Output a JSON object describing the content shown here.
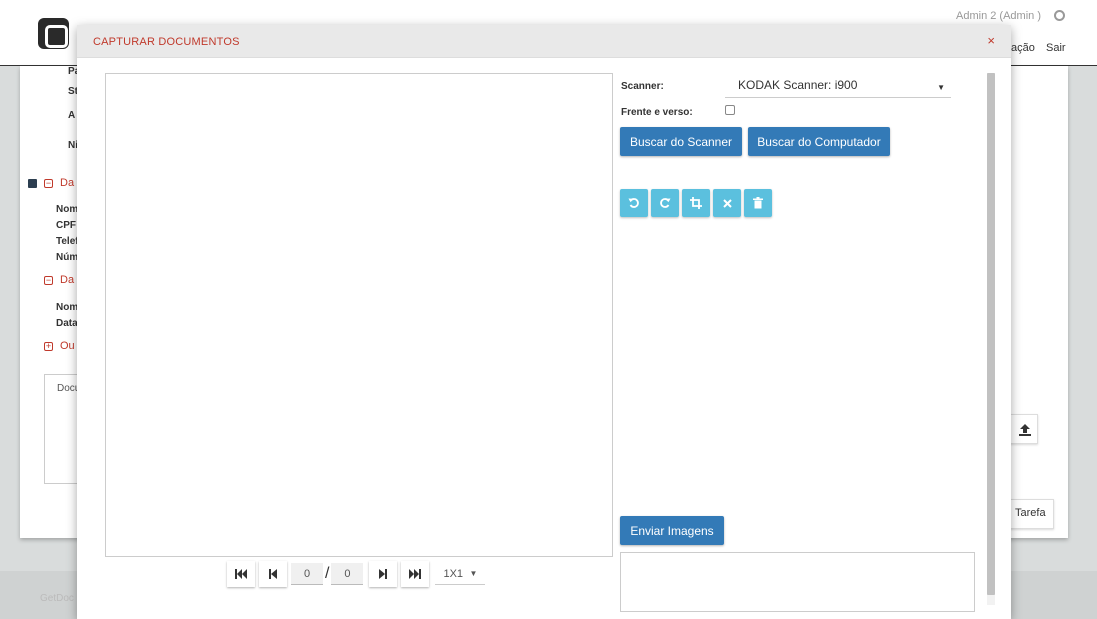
{
  "background": {
    "user": "Admin 2 (Admin )",
    "nav": [
      "ação",
      "Sair"
    ],
    "section_labels": [
      "Pa",
      "St",
      "A",
      "Ni"
    ],
    "sections": [
      "Da",
      "Da",
      "Ou"
    ],
    "fields_1": [
      "Nom",
      "CPF",
      "Telef",
      "Núm"
    ],
    "fields_2": [
      "Nom",
      "Data"
    ],
    "doc_label": "Docu",
    "footer_text": "GetDoc",
    "task_button": "Tarefa"
  },
  "modal": {
    "title": "CAPTURAR DOCUMENTOS",
    "close": "×"
  },
  "pager": {
    "current": "0",
    "separator": "/",
    "total": "0",
    "zoom": "1X1"
  },
  "scanner": {
    "label": "Scanner:",
    "selected": "KODAK Scanner: i900",
    "duplex_label": "Frente e verso:",
    "duplex_checked": false,
    "scan_button": "Buscar do Scanner",
    "computer_button": "Buscar do Computador",
    "send_button": "Enviar Imagens"
  },
  "colors": {
    "accent_red": "#c0392b",
    "primary": "#337ab7",
    "tool": "#5bc0de"
  },
  "icons": [
    "rotate-left-icon",
    "rotate-right-icon",
    "crop-icon",
    "close-icon",
    "trash-icon",
    "upload-icon",
    "user-icon"
  ]
}
